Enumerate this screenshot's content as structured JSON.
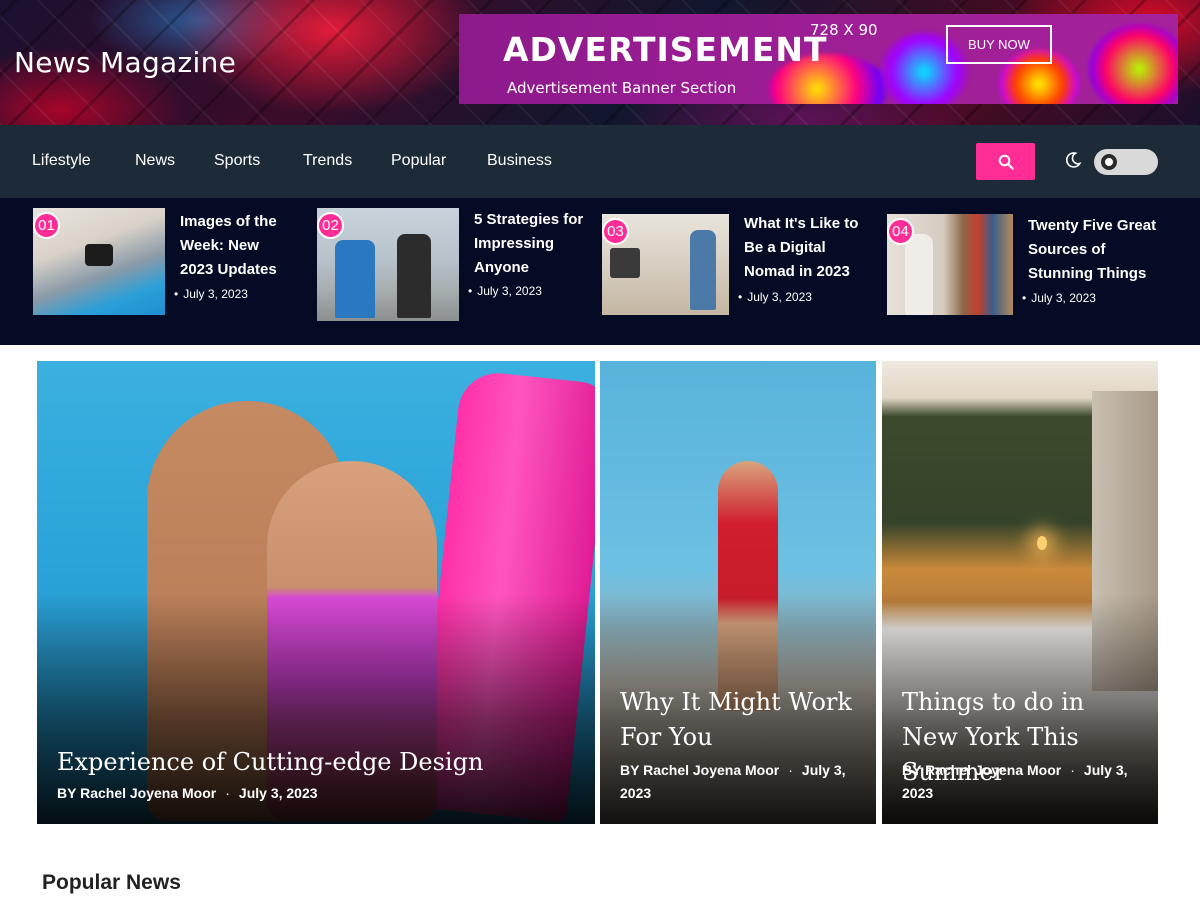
{
  "header": {
    "site_title": "News Magazine",
    "ad": {
      "title": "ADVERTISEMENT",
      "subtitle": "Advertisement Banner Section",
      "size_label": "728 X 90",
      "button_label": "BUY NOW"
    }
  },
  "nav": {
    "items": [
      {
        "label": "Lifestyle"
      },
      {
        "label": "News"
      },
      {
        "label": "Sports"
      },
      {
        "label": "Trends"
      },
      {
        "label": "Popular"
      },
      {
        "label": "Business"
      }
    ],
    "search_icon": "search-icon",
    "theme_icon": "moon-icon",
    "accent_color": "#ff2d95"
  },
  "trending": [
    {
      "number": "01",
      "title": "Images of the Week: New 2023 Updates",
      "date": "July 3, 2023"
    },
    {
      "number": "02",
      "title": "5 Strategies for Impressing Anyone",
      "date": "July 3, 2023"
    },
    {
      "number": "03",
      "title": "What It's Like to Be a Digital Nomad in 2023",
      "date": "July 3, 2023"
    },
    {
      "number": "04",
      "title": "Twenty Five Great Sources of Stunning Things",
      "date": "July 3, 2023"
    }
  ],
  "featured": [
    {
      "title": "Experience of Cutting-edge Design",
      "author": "BY Rachel Joyena Moor",
      "date": "July 3, 2023"
    },
    {
      "title": "Why It Might Work For You",
      "author": "BY Rachel Joyena Moor",
      "date": "July 3, 2023"
    },
    {
      "title": "Things to do in New York This Summer",
      "author": "BY Rachel Joyena Moor",
      "date": "July 3, 2023"
    }
  ],
  "sections": {
    "popular_title": "Popular News"
  }
}
